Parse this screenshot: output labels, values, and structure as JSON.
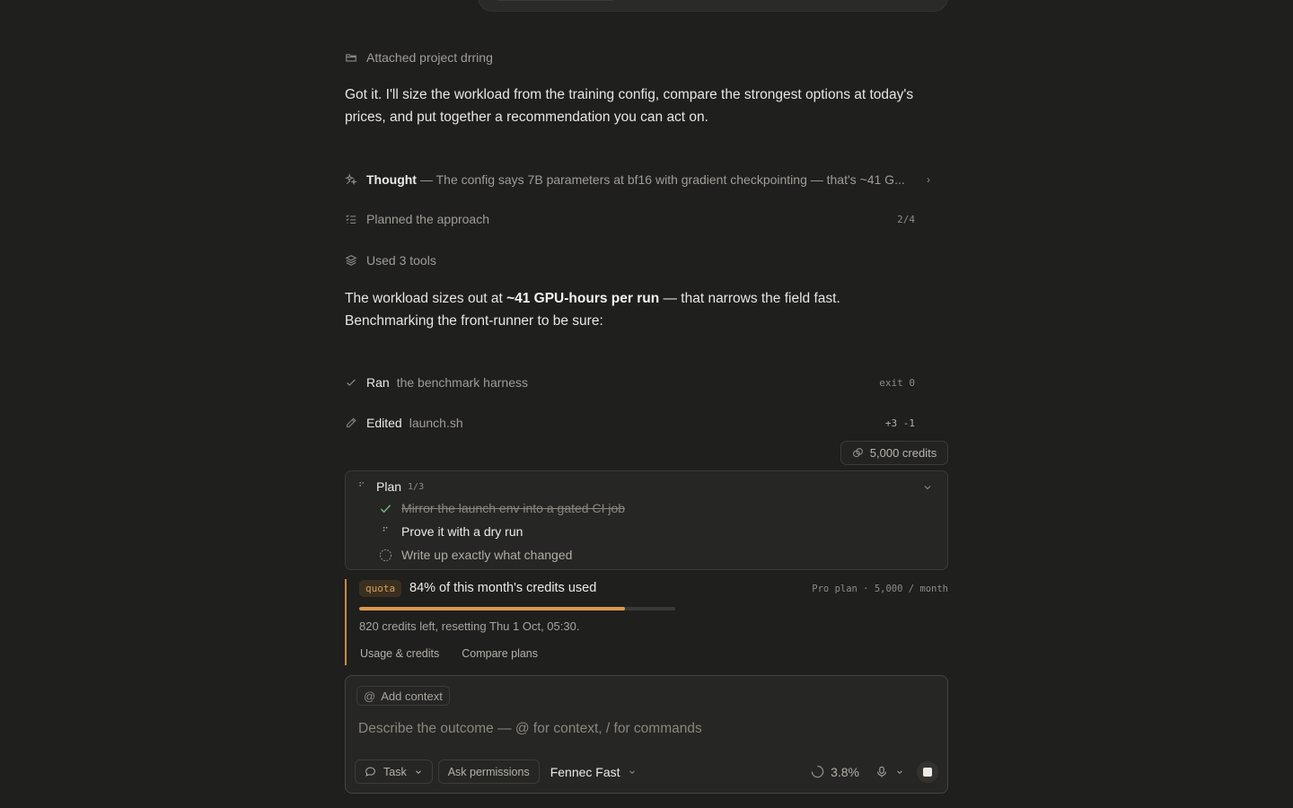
{
  "attached": {
    "label": "Attached project drring",
    "icon": "folder-icon"
  },
  "intro_text": "Got it. I'll size the workload from the training config, compare the strongest options at today's prices, and put together a recommendation you can act on.",
  "thought": {
    "label": "Thought",
    "summary": "— The config says 7B parameters at bf16 with gradient checkpointing — that's ~41 G...",
    "icon": "sparkle-icon"
  },
  "planned": {
    "label": "Planned the approach",
    "progress": "2/4",
    "icon": "checklist-icon"
  },
  "tools": {
    "label": "Used 3 tools",
    "icon": "layers-icon"
  },
  "workload_text": {
    "pre": "The workload sizes out at ",
    "bold": "~41 GPU-hours per run",
    "post": " — that narrows the field fast. Benchmarking the front-runner to be sure:"
  },
  "ran": {
    "verb": "Ran",
    "target": "the benchmark harness",
    "meta": "exit 0",
    "icon": "check-icon"
  },
  "edited": {
    "verb": "Edited",
    "target": "launch.sh",
    "meta": "+3 -1",
    "icon": "pencil-icon"
  },
  "credits_chip": {
    "label": "5,000 credits",
    "icon": "coins-icon"
  },
  "plan": {
    "title": "Plan",
    "count": "1/3",
    "items": [
      {
        "label": "Mirror the launch env into a gated CI job",
        "status": "done"
      },
      {
        "label": "Prove it with a dry run",
        "status": "active"
      },
      {
        "label": "Write up exactly what changed",
        "status": "pending"
      }
    ]
  },
  "quota": {
    "badge": "quota",
    "title": "84% of this month's credits used",
    "plan_info": "Pro plan · 5,000 / month",
    "used_fraction": 0.84,
    "subtitle": "820 credits left, resetting Thu 1 Oct, 05:30.",
    "links": [
      "Usage & credits",
      "Compare plans"
    ],
    "accent": "#d99a4e"
  },
  "composer": {
    "add_context": "Add context",
    "placeholder": "Describe the outcome — @ for context, / for commands",
    "mode": "Task",
    "permissions": "Ask permissions",
    "model": "Fennec Fast",
    "context_usage": "3.8%"
  }
}
